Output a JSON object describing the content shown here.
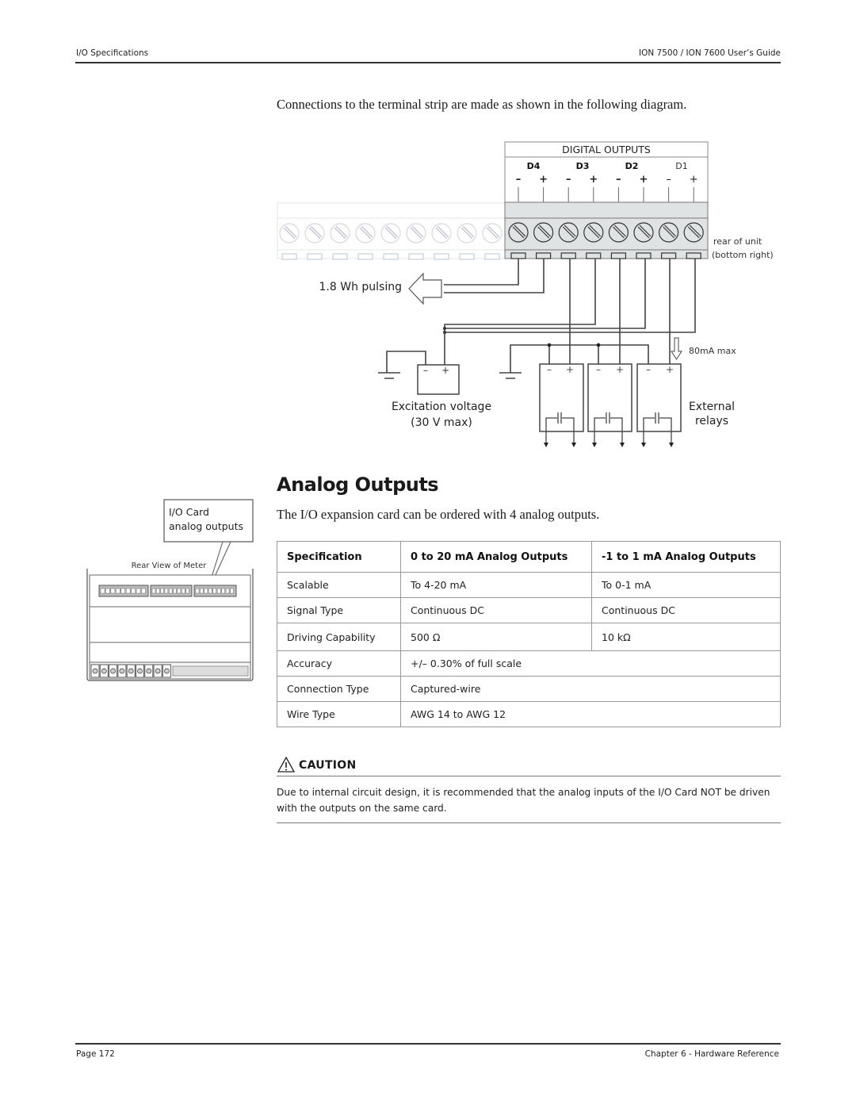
{
  "header": {
    "left": "I/O Specifications",
    "right": "ION 7500 / ION 7600 User’s Guide"
  },
  "intro_text": "Connections to the terminal strip are made as shown in the following diagram.",
  "wiring_diagram": {
    "title": "DIGITAL OUTPUTS",
    "channels": [
      "D4",
      "D3",
      "D2",
      "D1"
    ],
    "polarity_minus": "–",
    "polarity_plus": "+",
    "rear_label_line1": "rear of unit",
    "rear_label_line2": "(bottom right)",
    "pulsing_label": "1.8 Wh pulsing",
    "current_label": "80mA max",
    "excitation_line1": "Excitation voltage",
    "excitation_line2": "(30 V max)",
    "relays_line1": "External",
    "relays_line2": "relays"
  },
  "meter_diagram": {
    "callout_line1": "I/O Card",
    "callout_line2": "analog outputs",
    "caption": "Rear View of Meter"
  },
  "section": {
    "title": "Analog Outputs",
    "subtitle": "The I/O expansion card can be ordered with 4 analog outputs."
  },
  "spec_table": {
    "headers": [
      "Specification",
      "0 to 20 mA Analog Outputs",
      "-1 to 1 mA Analog Outputs"
    ],
    "rows": [
      [
        "Scalable",
        "To 4-20 mA",
        "To 0-1 mA"
      ],
      [
        "Signal Type",
        "Continuous DC",
        "Continuous DC"
      ],
      [
        "Driving Capability",
        "500 Ω",
        "10 kΩ"
      ],
      [
        "Accuracy",
        "+/– 0.30% of full scale"
      ],
      [
        "Connection Type",
        "Captured-wire"
      ],
      [
        "Wire Type",
        "AWG 14 to AWG 12"
      ]
    ]
  },
  "caution": {
    "title": "CAUTION",
    "body": "Due to internal circuit design, it is recommended that the analog inputs of the I/O Card NOT be driven with the outputs on the same card."
  },
  "footer": {
    "left": "Page 172",
    "right": "Chapter 6 - Hardware Reference"
  }
}
